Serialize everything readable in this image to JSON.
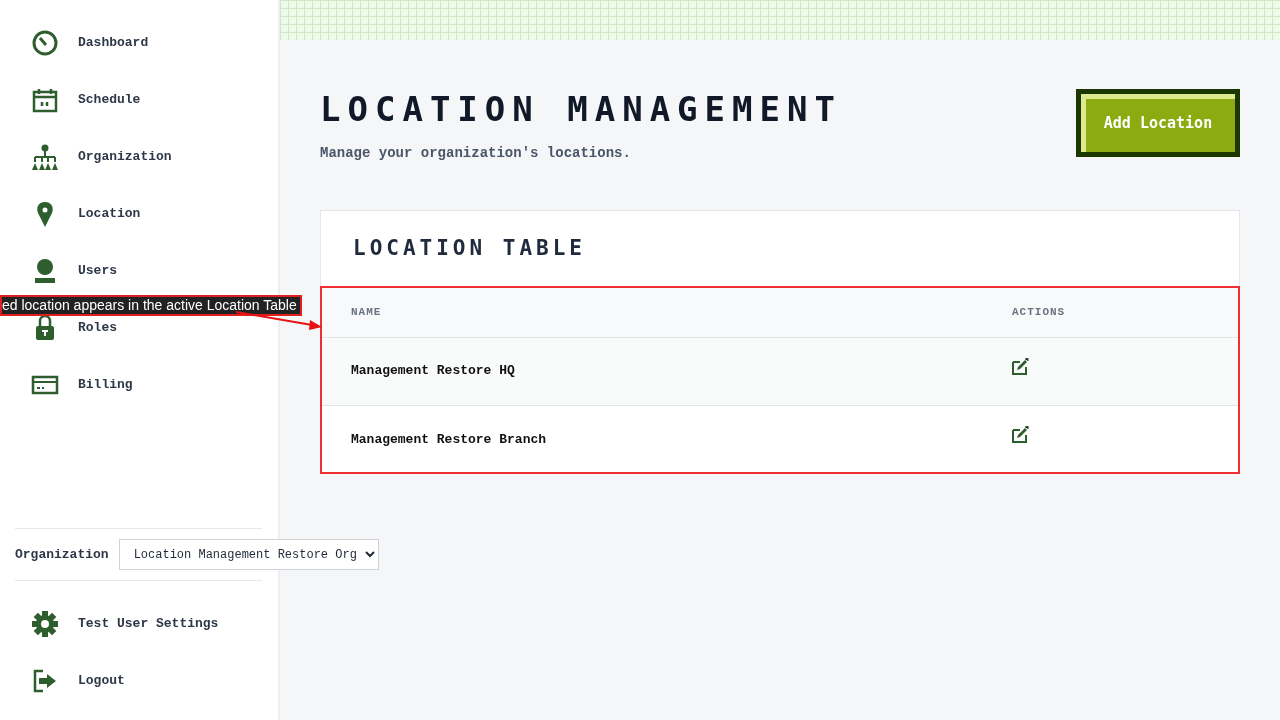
{
  "sidebar": {
    "nav_items": [
      {
        "kind": "gauge",
        "label": "Dashboard"
      },
      {
        "kind": "calendar",
        "label": "Schedule"
      },
      {
        "kind": "orgchart",
        "label": "Organization"
      },
      {
        "kind": "pin",
        "label": "Location"
      },
      {
        "kind": "user",
        "label": "Users"
      },
      {
        "kind": "lock",
        "label": "Roles"
      },
      {
        "kind": "card",
        "label": "Billing"
      }
    ],
    "organization": {
      "label": "Organization",
      "value": "Location Management Restore Org"
    },
    "footer_items": [
      {
        "kind": "gear",
        "label": "Test User Settings"
      },
      {
        "kind": "logout",
        "label": "Logout"
      }
    ]
  },
  "header": {
    "title": "LOCATION MANAGEMENT",
    "subtitle": "Manage your organization's locations.",
    "add_button": "Add Location"
  },
  "location_table": {
    "title": "LOCATION TABLE",
    "columns": [
      "NAME",
      "ACTIONS"
    ],
    "rows": [
      {
        "name": "Management Restore HQ"
      },
      {
        "name": "Management Restore Branch"
      }
    ]
  },
  "annotation": {
    "text": "ed location appears in the active Location Table"
  }
}
